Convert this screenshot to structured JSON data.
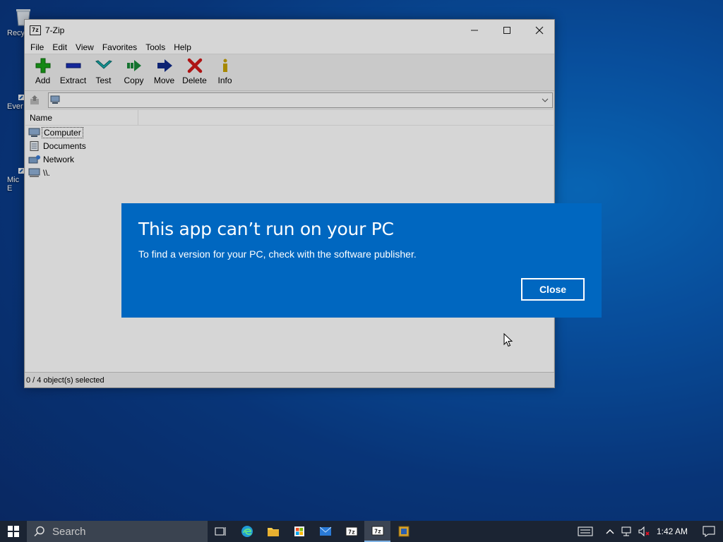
{
  "desktop": {
    "icons": [
      {
        "label": "Recy"
      },
      {
        "label": "Ever"
      },
      {
        "label": "Mic\nE"
      }
    ]
  },
  "window": {
    "title": "7-Zip",
    "app_icon_text": "7z",
    "menu": [
      "File",
      "Edit",
      "View",
      "Favorites",
      "Tools",
      "Help"
    ],
    "toolbar": [
      {
        "label": "Add",
        "icon": "plus-icon",
        "color": "#1aa31a"
      },
      {
        "label": "Extract",
        "icon": "minus-icon",
        "color": "#1a2fb8"
      },
      {
        "label": "Test",
        "icon": "check-icon",
        "color": "#1aa3a3"
      },
      {
        "label": "Copy",
        "icon": "copy-arrow-icon",
        "color": "#1a8a3a"
      },
      {
        "label": "Move",
        "icon": "move-arrow-icon",
        "color": "#102a8a"
      },
      {
        "label": "Delete",
        "icon": "x-icon",
        "color": "#d01818"
      },
      {
        "label": "Info",
        "icon": "info-icon",
        "color": "#c8a200"
      }
    ],
    "column_name": "Name",
    "items": [
      {
        "label": "Computer",
        "icon": "computer-icon",
        "selected": true
      },
      {
        "label": "Documents",
        "icon": "documents-icon",
        "selected": false
      },
      {
        "label": "Network",
        "icon": "network-icon",
        "selected": false
      },
      {
        "label": "\\\\.",
        "icon": "device-icon",
        "selected": false
      }
    ],
    "status": "0 / 4 object(s) selected"
  },
  "dialog": {
    "title": "This app can’t run on your PC",
    "message": "To find a version for your PC, check with the software publisher.",
    "close_label": "Close",
    "bg_color": "#0067c0"
  },
  "taskbar": {
    "search_placeholder": "Search",
    "clock": "1:42 AM"
  }
}
